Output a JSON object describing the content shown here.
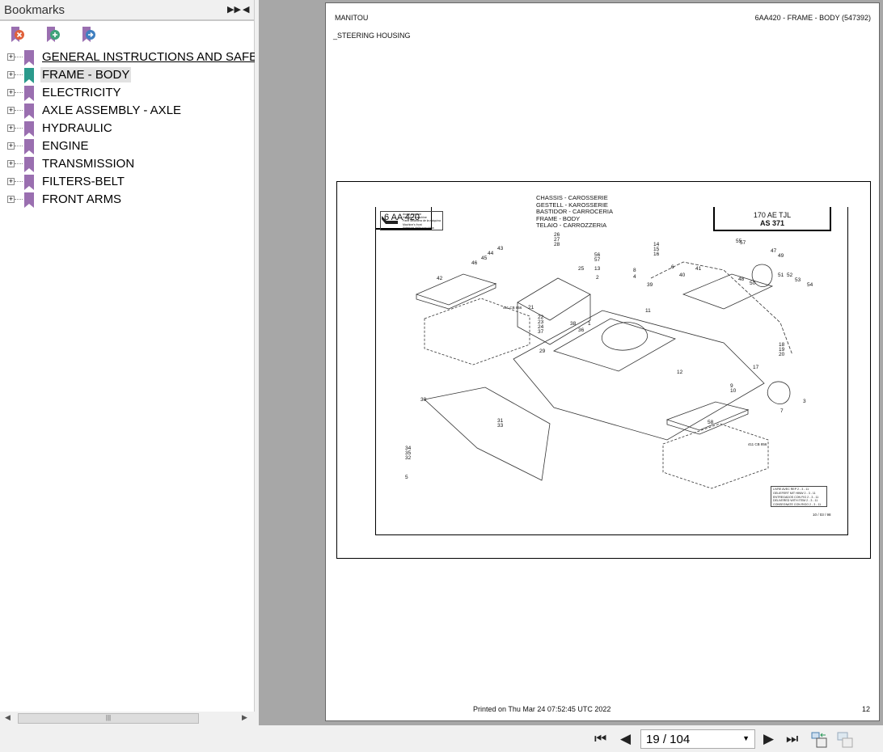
{
  "sidebar": {
    "title": "Bookmarks",
    "expand_icon": "double-arrow-right",
    "collapse_icon": "arrow-left",
    "tools": [
      "delete-bookmark",
      "add-bookmark",
      "go-to-bookmark"
    ],
    "items": [
      {
        "label": "GENERAL INSTRUCTIONS AND SAFETY"
      },
      {
        "label": "FRAME - BODY"
      },
      {
        "label": "ELECTRICITY"
      },
      {
        "label": "AXLE ASSEMBLY - AXLE"
      },
      {
        "label": "HYDRAULIC"
      },
      {
        "label": "ENGINE"
      },
      {
        "label": "TRANSMISSION"
      },
      {
        "label": "FILTERS-BELT"
      },
      {
        "label": "FRONT ARMS"
      }
    ]
  },
  "page": {
    "brand": "MANITOU",
    "ref": "6AA420 - FRAME - BODY (547392)",
    "section": "_STEERING HOUSING",
    "code": "6 AA 420",
    "titles": [
      "CHASSIS - CAROSSERIE",
      "GESTELL - KAROSSERIE",
      "BASTIDOR - CARROCERIA",
      "FRAME - BODY",
      "TELAIO - CARROZZERIA"
    ],
    "model": "170 AE TJL",
    "model_sub": "AS 371",
    "legend": [
      "Avant machine",
      "Vorn des maschine",
      "Parte delantera de la máquina",
      "Machine's front",
      "Anteriore della macchina"
    ],
    "note": [
      "LIVRE AVEC REP 2 - 3 - 11",
      "GELIEFERT MIT HINW 2 - 3 - 11",
      "ENTREGADOS CON FIG 2 - 3 - 11",
      "DELIVERED WITH ITEM 2 - 3 - 11",
      "CONSEGNATE CON RIGO 2 - 3 - 11"
    ],
    "date_code": "10 / 03 / 98",
    "ref_a": "411 CB 856",
    "ref_b": "411 CB 856",
    "callouts": [
      "26",
      "27",
      "28",
      "25",
      "14",
      "15",
      "16",
      "56",
      "57",
      "13",
      "2",
      "8",
      "4",
      "43",
      "44",
      "45",
      "46",
      "42",
      "21",
      "22",
      "23",
      "24",
      "37",
      "38",
      "36",
      "1",
      "29",
      "30",
      "31",
      "33",
      "34",
      "35",
      "32",
      "5",
      "39",
      "40",
      "41",
      "6",
      "11",
      "12",
      "58",
      "57",
      "55",
      "47",
      "49",
      "48",
      "50",
      "51",
      "52",
      "53",
      "54",
      "18",
      "19",
      "20",
      "17",
      "9",
      "10",
      "3",
      "7"
    ],
    "printed": "Printed on  Thu Mar 24 07:52:45 UTC 2022",
    "page_number": "12"
  },
  "toolbar": {
    "page_field": "19 / 104",
    "buttons": [
      "first-page",
      "previous-page",
      "next-page",
      "last-page",
      "fit-page",
      "fit-width"
    ]
  }
}
